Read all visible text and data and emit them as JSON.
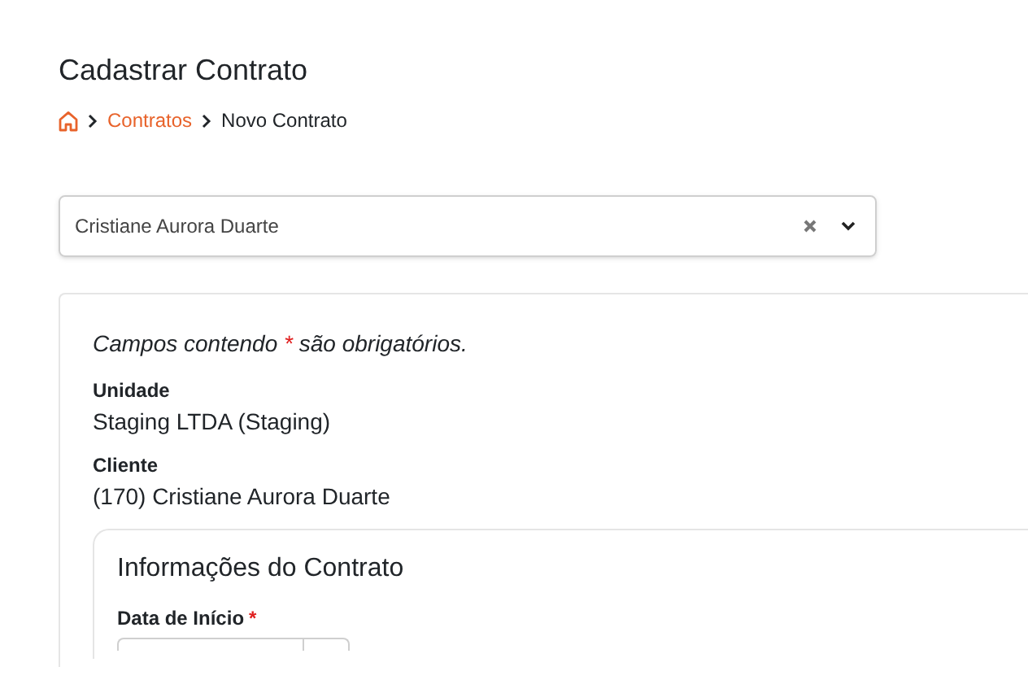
{
  "page_title": "Cadastrar Contrato",
  "breadcrumb": [
    {
      "label": "Contratos",
      "kind": "link"
    },
    {
      "label": "Novo Contrato",
      "kind": "current"
    }
  ],
  "client_select": {
    "value": "Cristiane Aurora Duarte"
  },
  "note": {
    "before": "Campos contendo",
    "mark": "*",
    "after": "são obrigatórios."
  },
  "fields": [
    {
      "label": "Unidade",
      "value": "Staging LTDA (Staging)"
    },
    {
      "label": "Cliente",
      "value": "(170) Cristiane Aurora Duarte"
    }
  ],
  "contract_section": {
    "title": "Informações do Contrato",
    "fields": [
      {
        "label": "Data de Início",
        "required": true
      }
    ]
  }
}
